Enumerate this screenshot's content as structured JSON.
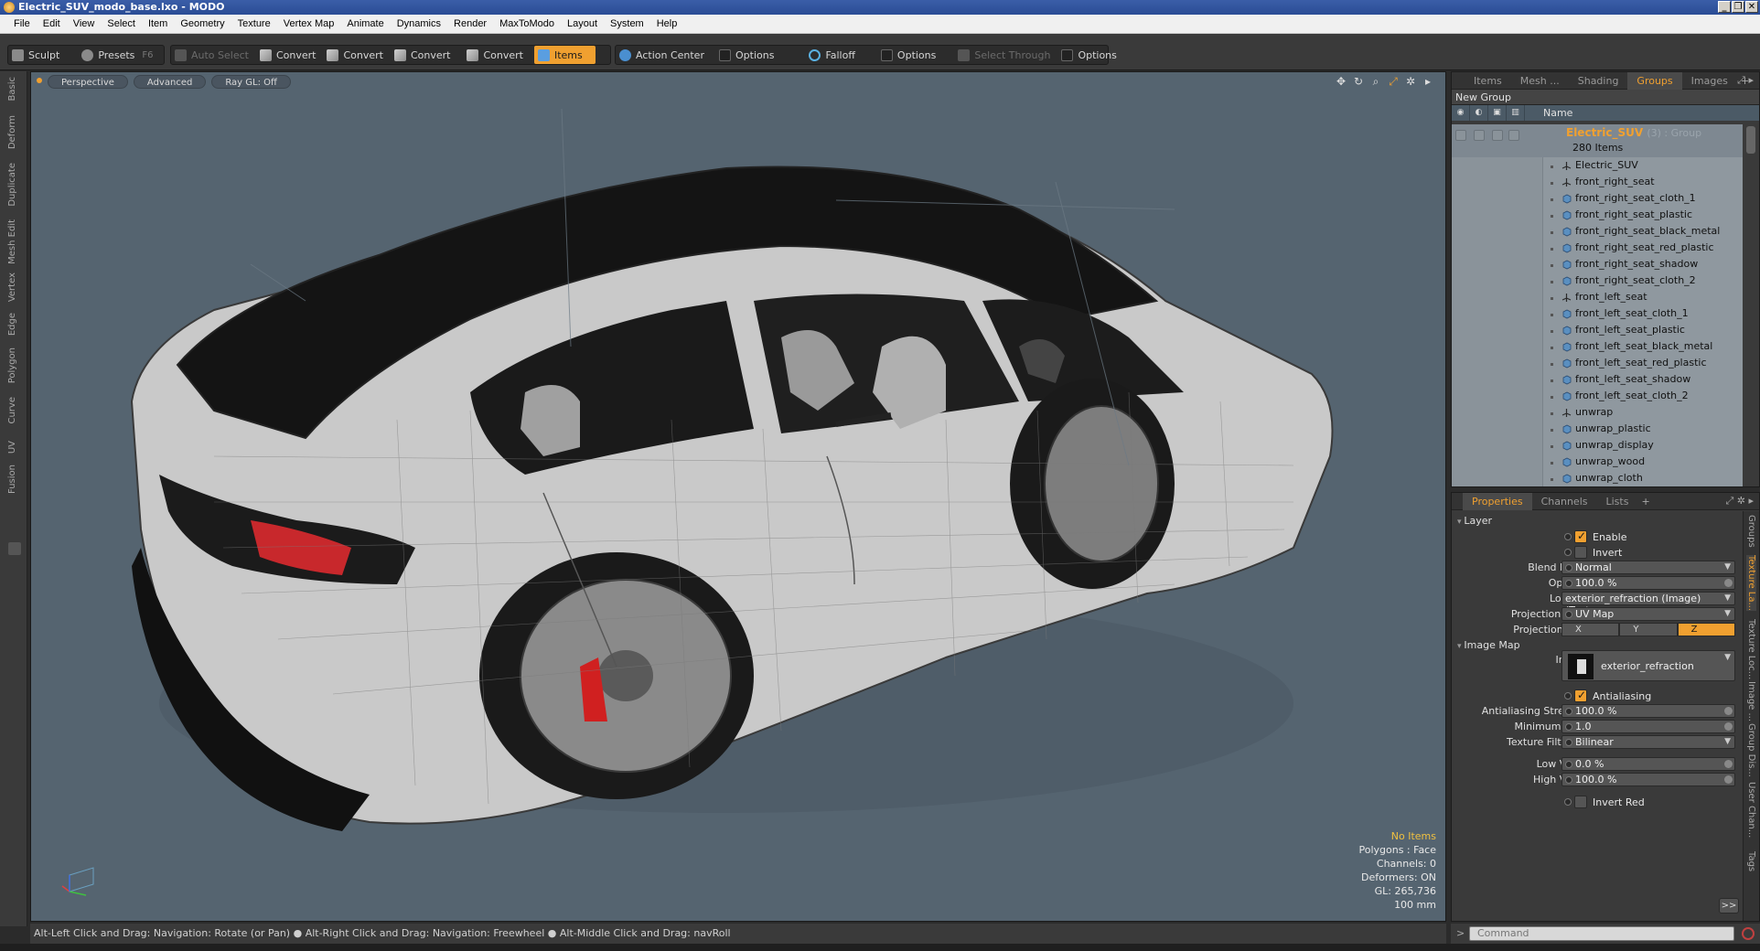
{
  "window": {
    "title": "Electric_SUV_modo_base.lxo - MODO"
  },
  "menu": [
    "File",
    "Edit",
    "View",
    "Select",
    "Item",
    "Geometry",
    "Texture",
    "Vertex Map",
    "Animate",
    "Dynamics",
    "Render",
    "MaxToModo",
    "Layout",
    "System",
    "Help"
  ],
  "toolbar": {
    "sculpt": "Sculpt",
    "presets": "Presets",
    "presets_hotkey": "F6",
    "auto_select": "Auto Select",
    "convert1": "Convert",
    "convert2": "Convert",
    "convert3": "Convert",
    "convert4": "Convert",
    "items": "Items",
    "action_center": "Action Center",
    "options1": "Options",
    "falloff": "Falloff",
    "options2": "Options",
    "select_through": "Select Through",
    "options3": "Options"
  },
  "left_tabs": [
    "Basic",
    "Deform",
    "Duplicate",
    "Mesh Edit",
    "Vertex",
    "Edge",
    "Polygon",
    "Curve",
    "UV",
    "Fusion"
  ],
  "viewport": {
    "view_mode": "Perspective",
    "shading": "Advanced",
    "raygl": "Ray GL: Off",
    "hud": {
      "items": "No Items",
      "polygons": "Polygons : Face",
      "channels": "Channels: 0",
      "deformers": "Deformers: ON",
      "gl": "GL: 265,736",
      "scale": "100 mm"
    }
  },
  "statusbar": {
    "text": "Alt-Left Click and Drag: Navigation: Rotate (or Pan) ● Alt-Right Click and Drag: Navigation: Freewheel ● Alt-Middle Click and Drag: navRoll"
  },
  "top_panel": {
    "tabs": [
      "Items",
      "Mesh ...",
      "Shading",
      "Groups",
      "Images"
    ],
    "active_tab": "Groups",
    "new_group": "New Group",
    "name_header": "Name",
    "group_name": "Electric_SUV",
    "group_type": "(3) : Group",
    "group_count": "280 Items",
    "items": [
      {
        "name": "Electric_SUV",
        "icon": "locator"
      },
      {
        "name": "front_right_seat",
        "icon": "locator"
      },
      {
        "name": "front_right_seat_cloth_1",
        "icon": "mesh"
      },
      {
        "name": "front_right_seat_plastic",
        "icon": "mesh"
      },
      {
        "name": "front_right_seat_black_metal",
        "icon": "mesh"
      },
      {
        "name": "front_right_seat_red_plastic",
        "icon": "mesh"
      },
      {
        "name": "front_right_seat_shadow",
        "icon": "mesh"
      },
      {
        "name": "front_right_seat_cloth_2",
        "icon": "mesh"
      },
      {
        "name": "front_left_seat",
        "icon": "locator"
      },
      {
        "name": "front_left_seat_cloth_1",
        "icon": "mesh"
      },
      {
        "name": "front_left_seat_plastic",
        "icon": "mesh"
      },
      {
        "name": "front_left_seat_black_metal",
        "icon": "mesh"
      },
      {
        "name": "front_left_seat_red_plastic",
        "icon": "mesh"
      },
      {
        "name": "front_left_seat_shadow",
        "icon": "mesh"
      },
      {
        "name": "front_left_seat_cloth_2",
        "icon": "mesh"
      },
      {
        "name": "unwrap",
        "icon": "locator"
      },
      {
        "name": "unwrap_plastic",
        "icon": "mesh"
      },
      {
        "name": "unwrap_display",
        "icon": "mesh"
      },
      {
        "name": "unwrap_wood",
        "icon": "mesh"
      },
      {
        "name": "unwrap_cloth",
        "icon": "mesh"
      }
    ]
  },
  "bottom_panel": {
    "tabs": [
      "Properties",
      "Channels",
      "Lists"
    ],
    "active_tab": "Properties",
    "section_layer": "Layer",
    "enable": "Enable",
    "invert": "Invert",
    "blend_mode_label": "Blend Mode",
    "blend_mode": "Normal",
    "opacity_label": "Opacity",
    "opacity": "100.0 %",
    "locator_label": "Locator",
    "locator": "exterior_refraction (Image) (Text...",
    "projection_type_label": "Projection Type",
    "projection_type": "UV Map",
    "projection_axis_label": "Projection Axis",
    "axes": [
      "X",
      "Y",
      "Z"
    ],
    "active_axis": "Z",
    "section_image_map": "Image Map",
    "image_label": "Image",
    "image": "exterior_refraction",
    "antialiasing": "Antialiasing",
    "aa_strength_label": "Antialiasing Strength",
    "aa_strength": "100.0 %",
    "min_spot_label": "Minimum Spot",
    "min_spot": "1.0",
    "tex_filter_label": "Texture Filtering",
    "tex_filter": "Bilinear",
    "low_value_label": "Low Value",
    "low_value": "0.0 %",
    "high_value_label": "High Value",
    "high_value": "100.0 %",
    "invert_red": "Invert Red",
    "more": ">>",
    "side_tabs": [
      "Groups",
      "Texture La...",
      "Texture Loc...",
      "Image ...",
      "Group Dis...",
      "User Chan...",
      "Tags"
    ]
  },
  "command": {
    "placeholder": "Command"
  },
  "colors": {
    "accent": "#f0a030",
    "viewport_bg": "#556470",
    "tree_bg": "#8f989f"
  }
}
